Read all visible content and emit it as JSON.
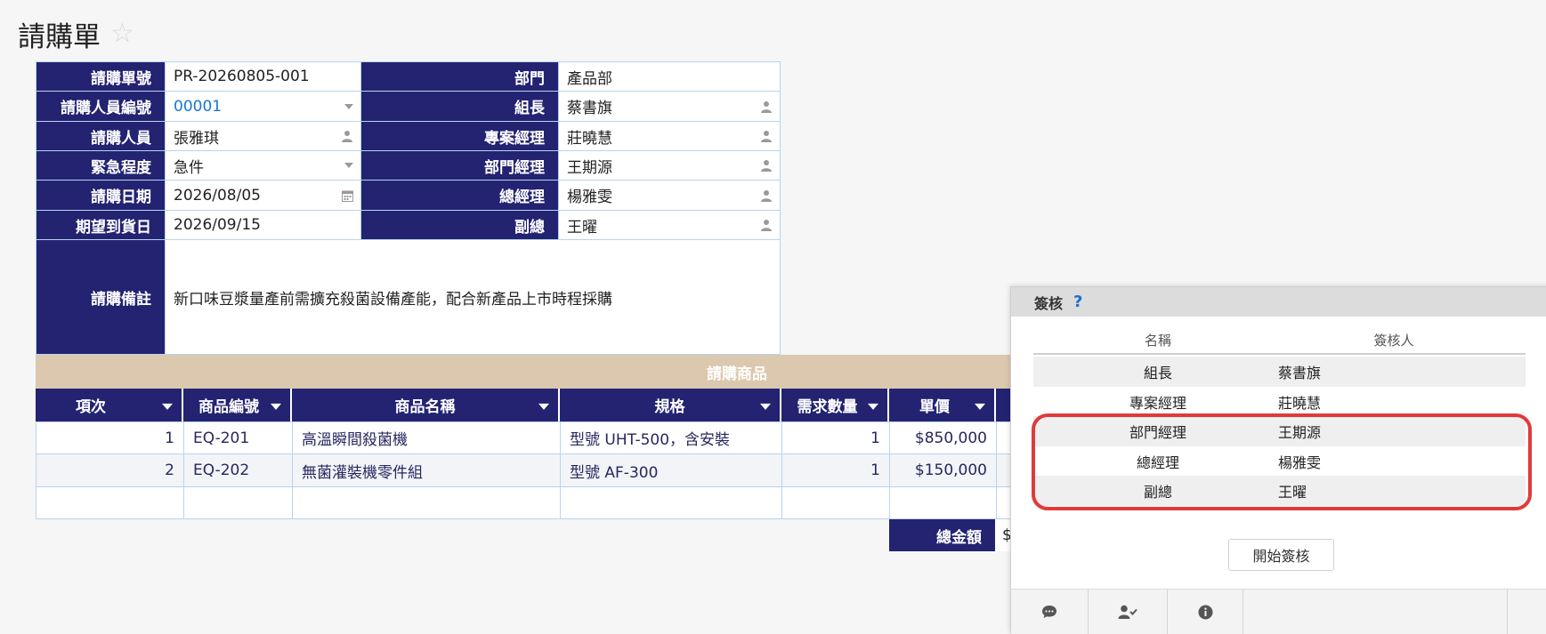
{
  "page": {
    "title": "請購單"
  },
  "form": {
    "left": [
      {
        "label": "請購單號",
        "value": "PR-20260805-001",
        "kind": "text"
      },
      {
        "label": "請購人員編號",
        "value": "00001",
        "kind": "dropdown-link"
      },
      {
        "label": "請購人員",
        "value": "張雅琪",
        "kind": "person"
      },
      {
        "label": "緊急程度",
        "value": "急件",
        "kind": "dropdown"
      },
      {
        "label": "請購日期",
        "value": "2026/08/05",
        "kind": "date"
      },
      {
        "label": "期望到貨日",
        "value": "2026/09/15",
        "kind": "text"
      }
    ],
    "right": [
      {
        "label": "部門",
        "value": "產品部",
        "kind": "text"
      },
      {
        "label": "組長",
        "value": "蔡書旗",
        "kind": "person"
      },
      {
        "label": "專案經理",
        "value": "莊曉慧",
        "kind": "person"
      },
      {
        "label": "部門經理",
        "value": "王期源",
        "kind": "person"
      },
      {
        "label": "總經理",
        "value": "楊雅雯",
        "kind": "person"
      },
      {
        "label": "副總",
        "value": "王曜",
        "kind": "person"
      }
    ],
    "remark_label": "請購備註",
    "remark_value": "新口味豆漿量產前需擴充殺菌設備產能，配合新產品上市時程採購"
  },
  "items_section": {
    "title": "請購商品",
    "columns": [
      "項次",
      "商品編號",
      "商品名稱",
      "規格",
      "需求數量",
      "單價"
    ],
    "rows": [
      {
        "no": "1",
        "code": "EQ-201",
        "name": "高溫瞬間殺菌機",
        "spec": "型號 UHT-500，含安裝",
        "qty": "1",
        "price": "$850,000"
      },
      {
        "no": "2",
        "code": "EQ-202",
        "name": "無菌灌裝機零件組",
        "spec": "型號 AF-300",
        "qty": "1",
        "price": "$150,000"
      }
    ],
    "total_label": "總金額",
    "total_value_visible": "$"
  },
  "sign_panel": {
    "title": "簽核",
    "help": "?",
    "columns": [
      "名稱",
      "簽核人"
    ],
    "rows": [
      {
        "role": "組長",
        "signer": "蔡書旗"
      },
      {
        "role": "專案經理",
        "signer": "莊曉慧"
      },
      {
        "role": "部門經理",
        "signer": "王期源"
      },
      {
        "role": "總經理",
        "signer": "楊雅雯"
      },
      {
        "role": "副總",
        "signer": "王曜"
      }
    ],
    "start_button": "開始簽核",
    "footer_icons": [
      "comment-icon",
      "user-check-icon",
      "info-icon"
    ]
  },
  "colors": {
    "header_navy": "#232372",
    "section_tan": "#dcc8ae",
    "link_blue": "#1976d2",
    "highlight_red": "#e03a3a"
  }
}
